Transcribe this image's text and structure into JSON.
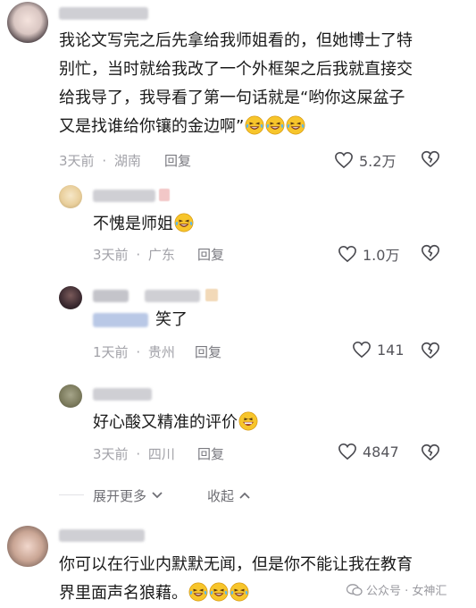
{
  "comments": [
    {
      "lines": [
        "我论文写完之后先拿给我师姐看的，但她博士了特",
        "别忙，当时就给我改了一个外框架之后我就直接交",
        "给我导了，我导看了第一句话就是“哟你这屎盆子",
        "又是找谁给你镶的金边啊”"
      ],
      "emoji": "laugh-cry-emoji",
      "emoji_count": 3,
      "time": "3天前",
      "location": "湖南",
      "reply_label": "回复",
      "likes": "5.2万"
    }
  ],
  "replies": [
    {
      "text": "不愧是师姐",
      "emoji": "laugh-cry-emoji",
      "time": "3天前",
      "location": "广东",
      "reply_label": "回复",
      "likes": "1.0万"
    },
    {
      "text": "笑了",
      "emoji": "",
      "time": "1天前",
      "location": "贵州",
      "reply_label": "回复",
      "likes": "141"
    },
    {
      "text": "好心酸又精准的评价",
      "emoji": "grin-emoji",
      "time": "3天前",
      "location": "四川",
      "reply_label": "回复",
      "likes": "4847"
    }
  ],
  "thread_controls": {
    "expand_label": "展开更多",
    "collapse_label": "收起"
  },
  "last_comment": {
    "lines": [
      "你可以在行业内默默无闻，但是你不能让我在教育",
      "界里面声名狼藉。"
    ],
    "emoji": "laugh-cry-emoji"
  },
  "watermark": "公众号 · 女神汇",
  "colors": {
    "meta": "#a2a2a8",
    "text": "#1a1a1a",
    "emoji_face": "#f7c52b"
  }
}
